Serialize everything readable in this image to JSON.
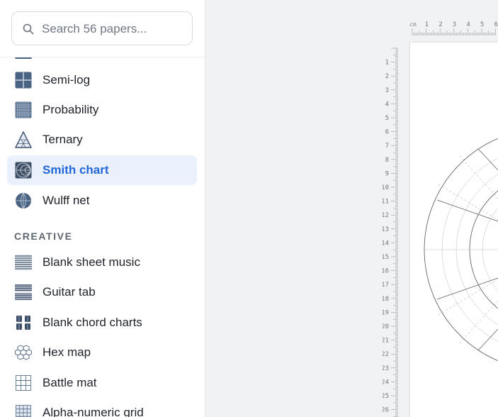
{
  "search": {
    "placeholder": "Search 56 papers..."
  },
  "sidebar": {
    "items": [
      {
        "label": "Semi-log",
        "icon": "semi-log-grid-icon",
        "active": false
      },
      {
        "label": "Probability",
        "icon": "probability-grid-icon",
        "active": false
      },
      {
        "label": "Ternary",
        "icon": "ternary-triangle-icon",
        "active": false
      },
      {
        "label": "Smith chart",
        "icon": "smith-chart-icon",
        "active": true
      },
      {
        "label": "Wulff net",
        "icon": "wulff-net-icon",
        "active": false
      }
    ],
    "section_creative": "CREATIVE",
    "creative_items": [
      {
        "label": "Blank sheet music",
        "icon": "staff-lines-icon"
      },
      {
        "label": "Guitar tab",
        "icon": "guitar-tab-icon"
      },
      {
        "label": "Blank chord charts",
        "icon": "chord-chart-icon"
      },
      {
        "label": "Hex map",
        "icon": "hex-map-icon"
      },
      {
        "label": "Battle mat",
        "icon": "battle-mat-grid-icon"
      },
      {
        "label": "Alpha-numeric grid",
        "icon": "alpha-numeric-grid-icon"
      }
    ]
  },
  "ruler": {
    "unit": "cm",
    "top_labels": [
      "1",
      "2",
      "3",
      "4",
      "5",
      "6"
    ],
    "left_labels": [
      "1",
      "2",
      "3",
      "4",
      "5",
      "6",
      "7",
      "8",
      "9",
      "10",
      "11",
      "12",
      "13",
      "14",
      "15",
      "16",
      "17",
      "18",
      "19",
      "20",
      "21",
      "22",
      "23",
      "24",
      "25",
      "26"
    ]
  },
  "colors": {
    "accent": "#2467d8",
    "active_bg": "#eaf1fd",
    "icon_fill": "#4b6382"
  }
}
